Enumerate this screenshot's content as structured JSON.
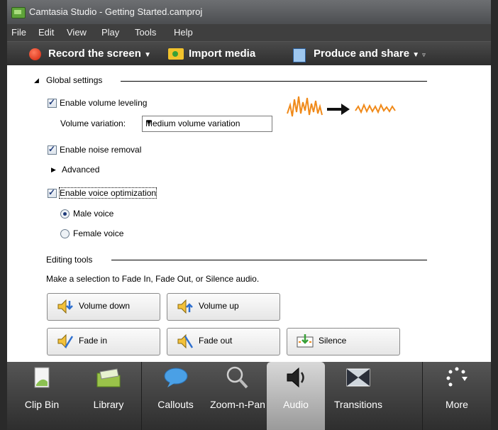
{
  "window": {
    "title": "Camtasia Studio - Getting Started.camproj"
  },
  "menu": {
    "items": [
      "File",
      "Edit",
      "View",
      "Play",
      "Tools",
      "Help"
    ]
  },
  "toolbar": {
    "record_label": "Record the screen",
    "import_label": "Import media",
    "produce_label": "Produce and share"
  },
  "global": {
    "section_label": "Global settings",
    "volume_leveling_label": "Enable volume leveling",
    "volume_leveling_checked": true,
    "volume_variation_label": "Volume variation:",
    "volume_variation_value": "Medium volume variation",
    "noise_removal_label": "Enable noise removal",
    "noise_removal_checked": true,
    "advanced_label": "Advanced",
    "voice_opt_label": "Enable voice optimization",
    "voice_opt_checked": true,
    "male_voice_label": "Male voice",
    "male_voice_selected": true,
    "female_voice_label": "Female voice",
    "female_voice_selected": false
  },
  "editing": {
    "section_label": "Editing tools",
    "instructions": "Make a selection to Fade In, Fade Out, or Silence audio.",
    "buttons": {
      "volume_down": "Volume down",
      "volume_up": "Volume up",
      "fade_in": "Fade in",
      "fade_out": "Fade out",
      "silence": "Silence"
    }
  },
  "tabs": {
    "clip_bin": "Clip Bin",
    "library": "Library",
    "callouts": "Callouts",
    "zoom_pan": "Zoom-n-Pan",
    "audio": "Audio",
    "transitions": "Transitions",
    "more": "More",
    "active": "Audio"
  },
  "colors": {
    "accent_orange": "#f08a1a",
    "record_red": "#d0220a",
    "selection_blue": "#1f3b7a"
  }
}
